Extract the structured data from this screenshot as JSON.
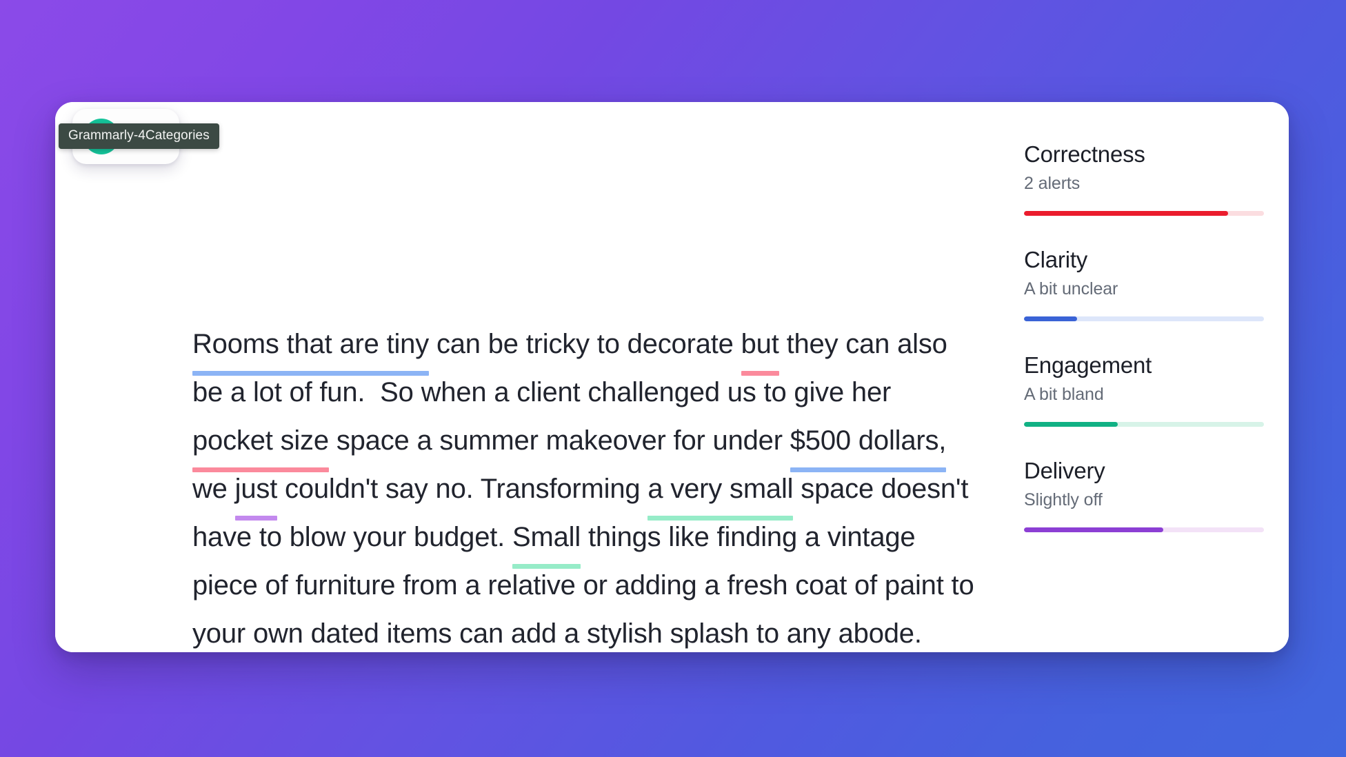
{
  "tooltip": {
    "label": "Grammarly-4Categories"
  },
  "widget": {
    "logo_icon": "grammarly-g-icon",
    "lines_icon": "document-lines-icon"
  },
  "document": {
    "segments": [
      {
        "text": "Rooms that are tiny",
        "underline": "blue"
      },
      {
        "text": " can be tricky to decorate ",
        "underline": "none"
      },
      {
        "text": "but",
        "underline": "red"
      },
      {
        "text": " they can also be a lot of fun.  So when a client challenged us to give her ",
        "underline": "none"
      },
      {
        "text": "pocket size",
        "underline": "red"
      },
      {
        "text": " space a summer makeover for under ",
        "underline": "none"
      },
      {
        "text": "$500 dollars,",
        "underline": "blue"
      },
      {
        "text": " we ",
        "underline": "none"
      },
      {
        "text": "just",
        "underline": "purple"
      },
      {
        "text": " couldn't say no. Transforming ",
        "underline": "none"
      },
      {
        "text": "a very small",
        "underline": "green"
      },
      {
        "text": " space doesn't have to blow your budget. ",
        "underline": "none"
      },
      {
        "text": "Small",
        "underline": "green"
      },
      {
        "text": " things like finding a vintage piece of furniture from a relative or adding a fresh coat of paint to your ",
        "underline": "none"
      },
      {
        "text": "own",
        "underline": "blue"
      },
      {
        "text": " dated items can add a stylish splash to any abode.",
        "underline": "none"
      }
    ],
    "full_text": "Rooms that are tiny can be tricky to decorate but they can also be a lot of fun.  So when a client challenged us to give her pocket size space a summer makeover for under $500 dollars, we just couldn't say no. Transforming a very small space doesn't have to blow your budget. Small things like finding a vintage piece of furniture from a relative or adding a fresh coat of paint to your own dated items can add a stylish splash to any abode.",
    "underline_colors": {
      "blue": "#8cb4f5",
      "red": "#fb8a9c",
      "green": "#96ecc8",
      "purple": "#c389ee"
    }
  },
  "sidebar": {
    "scores": [
      {
        "title": "Correctness",
        "status": "2 alerts",
        "percent": 85,
        "fill_color": "#eb1c2d",
        "track_color": "#fbdde0"
      },
      {
        "title": "Clarity",
        "status": "A bit unclear",
        "percent": 22,
        "fill_color": "#3a63d6",
        "track_color": "#dde6fa"
      },
      {
        "title": "Engagement",
        "status": "A bit bland",
        "percent": 39,
        "fill_color": "#11b184",
        "track_color": "#d7f3e8"
      },
      {
        "title": "Delivery",
        "status": "Slightly off",
        "percent": 58,
        "fill_color": "#8c3fd4",
        "track_color": "#f3e2f7"
      }
    ]
  },
  "background": {
    "gradient_from": "#8b4ae8",
    "gradient_to": "#4166de"
  }
}
